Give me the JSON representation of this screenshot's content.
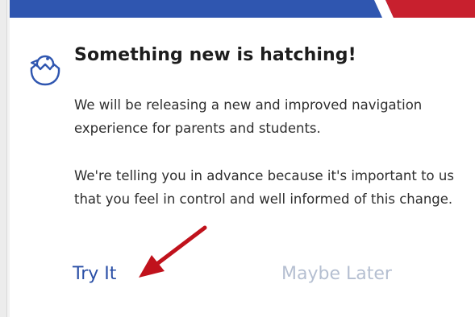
{
  "modal": {
    "title": "Something new is hatching!",
    "body_paragraphs": [
      "We will be releasing a new and improved navigation experience for parents and students.",
      "We're telling you in advance because it's important to us that you feel in control and well informed of this change."
    ],
    "buttons": {
      "try_it": "Try It",
      "maybe_later": "Maybe Later"
    },
    "icon": "hatching-chick-icon"
  },
  "annotation": {
    "icon": "arrow-icon",
    "color": "#c0121c"
  },
  "colors": {
    "brand_blue": "#2f56b0",
    "brand_red": "#c8202e",
    "link_blue": "#2a4fa6",
    "muted_link": "#b5bfd1"
  }
}
